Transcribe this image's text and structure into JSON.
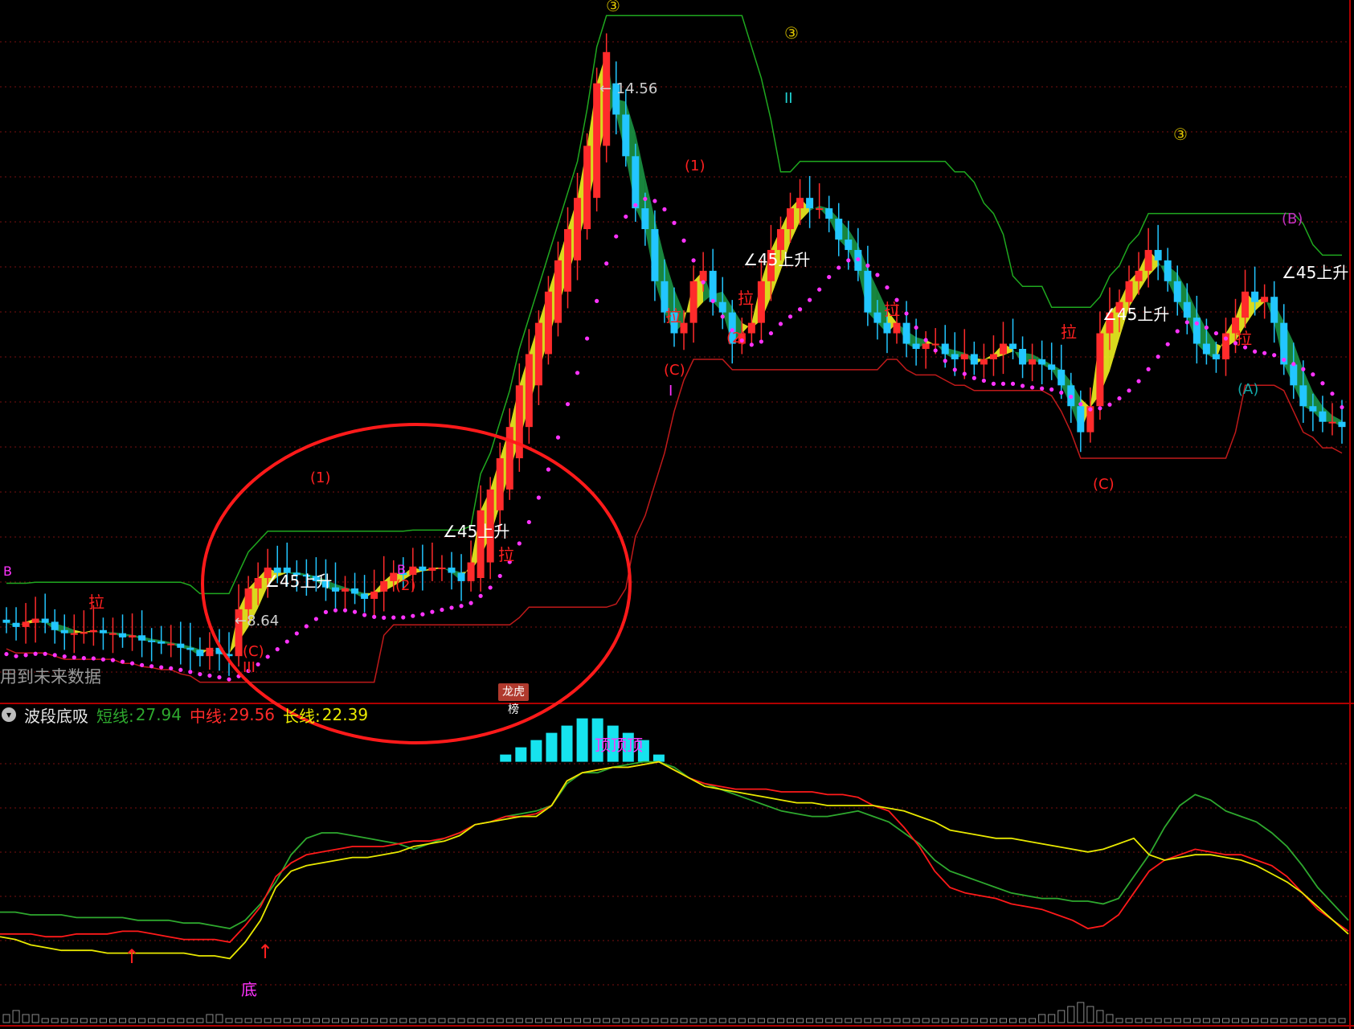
{
  "indicator": {
    "name": "波段底吸",
    "short_label": "短线:",
    "short_value": "27.94",
    "mid_label": "中线:",
    "mid_value": "29.56",
    "long_label": "长线:",
    "long_value": "22.39"
  },
  "notes": {
    "future_data": "用到未来数据",
    "dragon_tiger": "龙虎榜"
  },
  "colors": {
    "up": "#ff2b2b",
    "down": "#22c6ff",
    "ma_dots": "#ff33ff",
    "channel_upper": "#1fa81f",
    "channel_lower": "#c01a1a",
    "ribbon_up": "#ffff22",
    "ribbon_down": "#1c9c48",
    "short": "#2ea82e",
    "mid": "#ff1a1a",
    "long": "#e8e800",
    "hist": "#16e3ee",
    "circle": "#ff1a1a"
  },
  "chart_data": [
    {
      "type": "candlestick",
      "x": [
        1,
        2,
        3,
        4,
        5,
        6,
        7,
        8,
        9,
        10,
        11,
        12,
        13,
        14,
        15,
        16,
        17,
        18,
        19,
        20,
        21,
        22,
        23,
        24,
        25,
        26,
        27,
        28,
        29,
        30,
        31,
        32,
        33,
        34,
        35,
        36,
        37,
        38,
        39,
        40,
        41,
        42,
        43,
        44,
        45,
        46,
        47,
        48,
        49,
        50,
        51,
        52,
        53,
        54,
        55,
        56,
        57,
        58,
        59,
        60,
        61,
        62,
        63,
        64,
        65,
        66,
        67,
        68,
        69,
        70,
        71,
        72,
        73,
        74,
        75,
        76,
        77,
        78,
        79,
        80,
        81,
        82,
        83,
        84,
        85,
        86,
        87,
        88,
        89,
        90,
        91,
        92,
        93,
        94,
        95,
        96,
        97,
        98,
        99,
        100,
        101,
        102,
        103,
        104,
        105,
        106,
        107,
        108,
        109,
        110,
        111,
        112,
        113,
        114,
        115,
        116,
        117,
        118,
        119,
        120,
        121,
        122,
        123,
        124,
        125,
        126,
        127,
        128,
        129,
        130,
        131,
        132,
        133,
        134,
        135,
        136,
        137,
        138,
        139,
        140,
        141
      ],
      "open": [
        9.05,
        9.02,
        8.98,
        9.02,
        9.06,
        9.03,
        8.95,
        8.92,
        8.92,
        8.93,
        8.95,
        8.92,
        8.92,
        8.88,
        8.9,
        8.85,
        8.84,
        8.82,
        8.82,
        8.78,
        8.76,
        8.7,
        8.78,
        8.72,
        8.7,
        9.15,
        9.35,
        9.45,
        9.55,
        9.55,
        9.5,
        9.48,
        9.47,
        9.42,
        9.36,
        9.32,
        9.35,
        9.3,
        9.25,
        9.32,
        9.42,
        9.5,
        9.48,
        9.56,
        9.52,
        9.55,
        9.55,
        9.5,
        9.42,
        9.45,
        9.6,
        10.1,
        10.3,
        10.6,
        10.9,
        11.3,
        11.6,
        11.9,
        12.2,
        12.5,
        12.8,
        13.1,
        13.6,
        14.2,
        13.9,
        13.5,
        13.0,
        12.8,
        12.3,
        12.0,
        11.8,
        11.9,
        12.3,
        12.4,
        12.1,
        12.0,
        11.7,
        11.8,
        11.9,
        12.3,
        12.6,
        12.8,
        13.0,
        13.1,
        13.0,
        13.0,
        12.9,
        12.7,
        12.6,
        12.4,
        12.0,
        11.9,
        11.8,
        11.9,
        11.7,
        11.65,
        11.7,
        11.7,
        11.6,
        11.55,
        11.6,
        11.5,
        11.55,
        11.6,
        11.7,
        11.65,
        11.5,
        11.55,
        11.5,
        11.45,
        11.3,
        11.1,
        10.85,
        11.1,
        11.8,
        12.0,
        12.1,
        12.3,
        12.4,
        12.6,
        12.5,
        12.3,
        12.1,
        11.95,
        11.7,
        11.6,
        11.55,
        11.8,
        11.95,
        12.2,
        12.1,
        12.15,
        11.9,
        11.5,
        11.3,
        11.1,
        11.05,
        10.95,
        10.95
      ],
      "close": [
        9.02,
        8.98,
        9.03,
        9.06,
        9.02,
        8.95,
        8.92,
        8.92,
        8.93,
        8.95,
        8.92,
        8.92,
        8.88,
        8.9,
        8.85,
        8.84,
        8.82,
        8.82,
        8.78,
        8.76,
        8.7,
        8.78,
        8.72,
        8.7,
        9.15,
        9.35,
        9.45,
        9.55,
        9.5,
        9.5,
        9.48,
        9.47,
        9.42,
        9.36,
        9.32,
        9.35,
        9.3,
        9.25,
        9.32,
        9.42,
        9.5,
        9.48,
        9.56,
        9.52,
        9.55,
        9.55,
        9.5,
        9.42,
        9.6,
        10.1,
        10.3,
        10.6,
        10.9,
        11.3,
        11.6,
        11.9,
        12.2,
        12.5,
        12.8,
        13.1,
        13.6,
        14.2,
        14.5,
        13.9,
        13.5,
        13.0,
        12.8,
        12.3,
        12.0,
        11.8,
        11.9,
        12.3,
        12.4,
        12.1,
        12.0,
        11.7,
        11.8,
        11.9,
        12.3,
        12.6,
        12.8,
        13.0,
        13.1,
        13.0,
        13.0,
        12.9,
        12.7,
        12.6,
        12.4,
        12.0,
        11.9,
        11.8,
        11.9,
        11.7,
        11.65,
        11.7,
        11.7,
        11.6,
        11.55,
        11.6,
        11.5,
        11.55,
        11.6,
        11.7,
        11.65,
        11.5,
        11.55,
        11.5,
        11.45,
        11.3,
        11.1,
        10.85,
        11.1,
        11.8,
        12.0,
        12.1,
        12.3,
        12.4,
        12.6,
        12.5,
        12.3,
        12.1,
        11.95,
        11.7,
        11.6,
        11.55,
        11.8,
        11.95,
        12.2,
        12.1,
        12.15,
        11.9,
        11.5,
        11.3,
        11.1,
        11.05,
        10.95,
        10.95,
        10.9
      ],
      "volume": [
        2,
        3,
        2,
        2,
        1,
        1,
        1,
        1,
        1,
        1,
        1,
        1,
        1,
        1,
        1,
        1,
        1,
        1,
        1,
        1,
        1,
        2,
        2,
        1,
        1,
        1,
        1,
        1,
        1,
        1,
        1,
        1,
        1,
        1,
        1,
        1,
        1,
        1,
        1,
        1,
        1,
        1,
        1,
        1,
        1,
        1,
        1,
        1,
        1,
        1,
        1,
        1,
        1,
        1,
        1,
        1,
        1,
        1,
        1,
        1,
        1,
        1,
        1,
        1,
        1,
        1,
        1,
        1,
        1,
        1,
        1,
        1,
        1,
        1,
        1,
        1,
        1,
        1,
        1,
        1,
        1,
        1,
        1,
        1,
        1,
        1,
        1,
        1,
        1,
        1,
        1,
        1,
        1,
        1,
        1,
        1,
        1,
        1,
        1,
        1,
        1,
        1,
        1,
        1,
        1,
        1,
        1,
        2,
        2,
        3,
        4,
        5,
        4,
        3,
        2,
        1,
        1,
        1,
        1,
        1,
        1,
        1,
        1,
        1,
        1,
        1,
        1,
        1,
        1,
        1,
        1,
        1,
        1,
        1,
        1,
        1,
        1,
        1,
        1,
        1
      ],
      "yrange": [
        8.3,
        15.0
      ],
      "annotations": [
        "14.56",
        "8.64",
        "45上升",
        "拉",
        "(1)",
        "(2)",
        "(C)",
        "(A)",
        "(B)",
        "I",
        "II",
        "III",
        "B",
        "③"
      ],
      "grid": true
    },
    {
      "type": "line",
      "title": "波段底吸",
      "series": [
        {
          "name": "短线",
          "values": [
            31,
            31,
            30,
            30,
            30,
            29,
            29,
            29,
            29,
            28,
            28,
            28,
            27,
            27,
            26,
            25,
            28,
            34,
            42,
            52,
            58,
            60,
            60,
            59,
            58,
            57,
            56,
            54,
            56,
            58,
            60,
            63,
            64,
            66,
            67,
            68,
            70,
            78,
            82,
            82,
            84,
            85,
            86,
            86,
            84,
            80,
            78,
            76,
            74,
            72,
            70,
            68,
            67,
            66,
            66,
            67,
            68,
            66,
            64,
            60,
            56,
            50,
            46,
            44,
            42,
            40,
            38,
            37,
            36,
            36,
            35,
            35,
            34,
            36,
            44,
            52,
            62,
            70,
            74,
            72,
            68,
            66,
            64,
            60,
            55,
            48,
            40,
            34,
            28
          ]
        },
        {
          "name": "中线",
          "values": [
            23,
            23,
            23,
            22,
            22,
            23,
            23,
            23,
            24,
            24,
            23,
            22,
            21,
            21,
            21,
            20,
            26,
            33,
            44,
            49,
            52,
            53,
            54,
            55,
            55,
            55,
            56,
            57,
            57,
            58,
            60,
            63,
            64,
            66,
            66,
            67,
            70,
            79,
            82,
            83,
            84,
            84,
            85,
            86,
            83,
            80,
            78,
            77,
            76,
            76,
            76,
            75,
            75,
            75,
            74,
            74,
            73,
            70,
            68,
            62,
            55,
            46,
            40,
            38,
            37,
            36,
            34,
            33,
            32,
            30,
            28,
            25,
            26,
            30,
            38,
            46,
            50,
            52,
            54,
            53,
            52,
            52,
            50,
            48,
            44,
            38,
            32,
            28,
            24
          ]
        },
        {
          "name": "长线",
          "values": [
            22,
            21,
            19,
            18,
            17,
            17,
            17,
            16,
            16,
            16,
            16,
            16,
            16,
            15,
            15,
            14,
            20,
            28,
            40,
            46,
            48,
            49,
            50,
            51,
            51,
            52,
            53,
            55,
            56,
            57,
            59,
            63,
            64,
            65,
            66,
            66,
            70,
            79,
            82,
            83,
            84,
            84,
            85,
            86,
            83,
            80,
            77,
            76,
            75,
            74,
            73,
            72,
            71,
            71,
            70,
            70,
            70,
            70,
            69,
            68,
            66,
            64,
            61,
            60,
            59,
            58,
            58,
            57,
            56,
            55,
            54,
            53,
            54,
            56,
            58,
            52,
            50,
            51,
            52,
            52,
            51,
            50,
            48,
            45,
            42,
            38,
            33,
            28,
            23
          ]
        }
      ],
      "histogram": [
        0,
        0,
        0,
        0,
        0,
        0,
        0,
        0,
        0,
        0,
        0,
        0,
        0,
        0,
        0,
        0,
        0,
        0,
        0,
        0,
        0,
        0,
        0,
        0,
        0,
        0,
        0,
        0,
        0,
        0,
        0,
        0,
        0,
        1,
        2,
        3,
        4,
        5,
        6,
        6,
        5,
        4,
        3,
        1,
        0,
        0,
        0,
        0,
        0,
        0,
        0,
        0,
        0,
        0,
        0,
        0,
        0,
        0,
        0,
        0,
        0,
        0,
        0,
        0,
        0,
        0,
        0,
        0,
        0,
        0,
        0,
        0,
        0,
        0,
        0,
        0,
        0,
        0,
        0,
        0,
        0,
        0,
        0,
        0,
        0,
        0,
        0,
        0,
        0
      ],
      "annotations": [
        "底",
        "顶顶顶",
        "↑"
      ],
      "yrange": [
        0,
        100
      ]
    }
  ]
}
